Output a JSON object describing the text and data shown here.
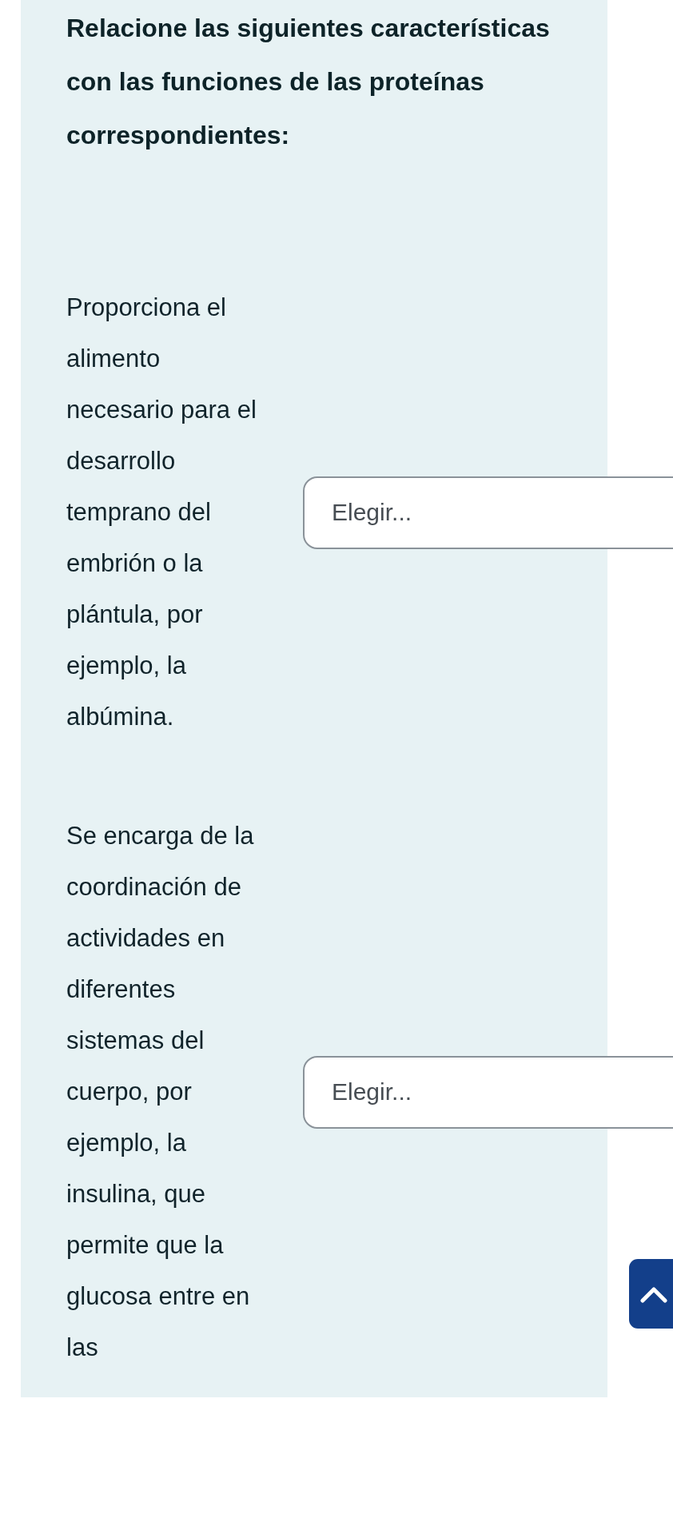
{
  "question": {
    "prompt": "Relacione las siguientes características con las funciones de las proteínas correspondientes:"
  },
  "matches": [
    {
      "statement": "Proporciona el alimento necesario para el desarrollo temprano del embrión o la plántula, por ejemplo, la albúmina.",
      "answer": "Elegir..."
    },
    {
      "statement": "Se encarga de la coordinación de actividades en diferentes sistemas del cuerpo, por ejemplo, la insulina, que permite que la glucosa entre en las",
      "answer": "Elegir..."
    }
  ]
}
